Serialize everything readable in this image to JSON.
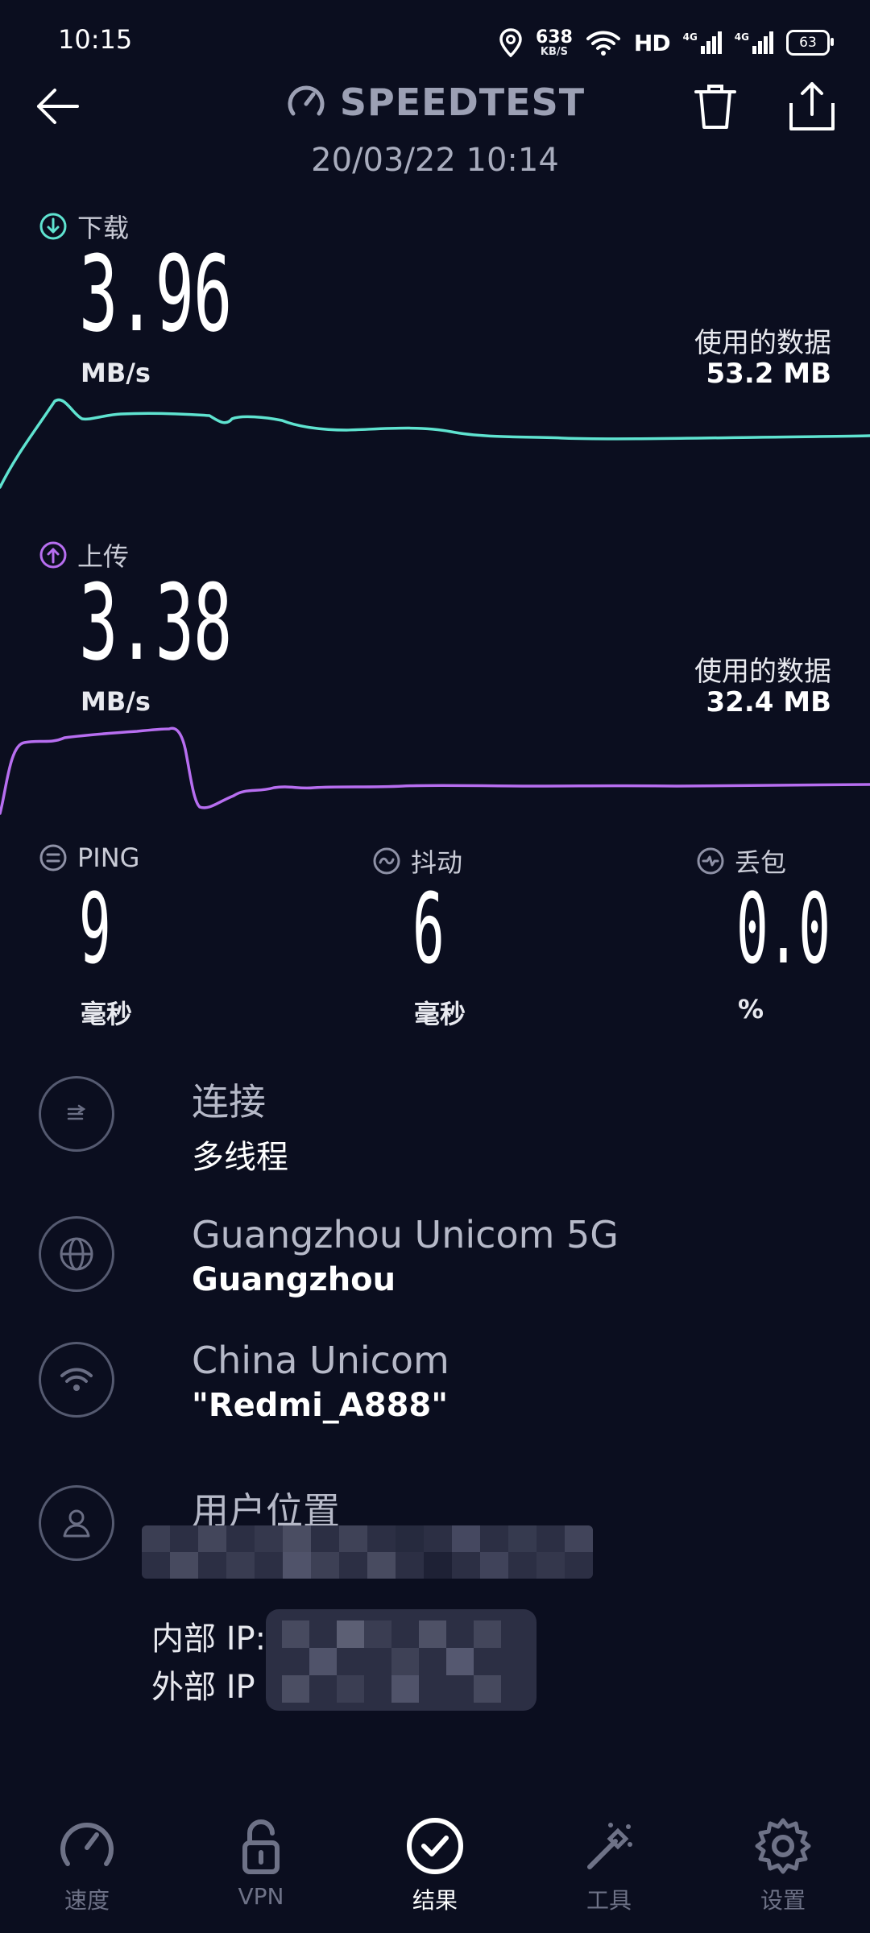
{
  "status_bar": {
    "time": "10:15",
    "net_rate_value": "638",
    "net_rate_unit": "KB/S",
    "hd_label": "HD",
    "sim1_label": "4G",
    "sim2_label": "4G",
    "battery": "63"
  },
  "header": {
    "title": "SPEEDTEST",
    "datetime": "20/03/22 10:14"
  },
  "download": {
    "label": "下载",
    "value": "3.96",
    "unit": "MB/s",
    "data_used_label": "使用的数据",
    "data_used_value": "53.2 MB",
    "color": "#5fe3d0"
  },
  "upload": {
    "label": "上传",
    "value": "3.38",
    "unit": "MB/s",
    "data_used_label": "使用的数据",
    "data_used_value": "32.4 MB",
    "color": "#b76ef0"
  },
  "metrics": {
    "ping": {
      "label": "PING",
      "value": "9",
      "unit": "毫秒"
    },
    "jitter": {
      "label": "抖动",
      "value": "6",
      "unit": "毫秒"
    },
    "loss": {
      "label": "丢包",
      "value": "0.0",
      "unit": "%"
    }
  },
  "info": {
    "connection": {
      "title": "连接",
      "subtitle": "多线程"
    },
    "server": {
      "title": "Guangzhou Unicom 5G",
      "subtitle": "Guangzhou"
    },
    "network": {
      "title": "China Unicom",
      "subtitle": "\"Redmi_A888\""
    },
    "location": {
      "title": "用户位置"
    },
    "ip": {
      "internal_label": "内部 IP:",
      "external_label": "外部 IP"
    }
  },
  "nav": {
    "items": [
      {
        "label": "速度",
        "icon": "speedometer-icon"
      },
      {
        "label": "VPN",
        "icon": "lock-icon"
      },
      {
        "label": "结果",
        "icon": "check-circle-icon"
      },
      {
        "label": "工具",
        "icon": "magic-wand-icon"
      },
      {
        "label": "设置",
        "icon": "gear-icon"
      }
    ],
    "active_index": 2
  }
}
